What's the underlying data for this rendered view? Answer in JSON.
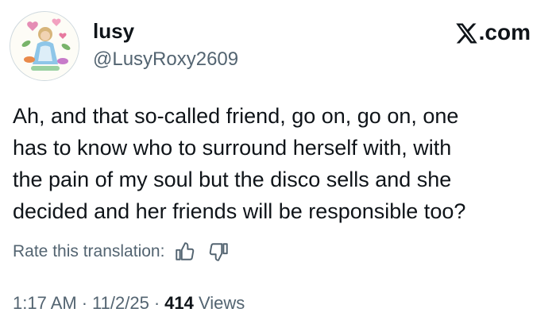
{
  "author": {
    "display_name": "lusy",
    "handle": "@LusyRoxy2609"
  },
  "brand": {
    "label": ".com",
    "icon": "x-logo-icon"
  },
  "tweet": {
    "lines": [
      "Ah, and that so-called friend, go on, go on, one",
      "has to know who to surround herself with, with",
      "the pain of my soul but the disco sells and she",
      "decided and her friends will be responsible too?"
    ]
  },
  "translation": {
    "label": "Rate this translation:",
    "thumbs_up_icon": "thumbs-up-icon",
    "thumbs_down_icon": "thumbs-down-icon"
  },
  "meta": {
    "time": "1:17 AM",
    "separator": "·",
    "date": "11/2/25",
    "views_count": "414",
    "views_label": "Views"
  },
  "colors": {
    "text_primary": "#0f1419",
    "text_secondary": "#536471",
    "background": "#ffffff"
  }
}
